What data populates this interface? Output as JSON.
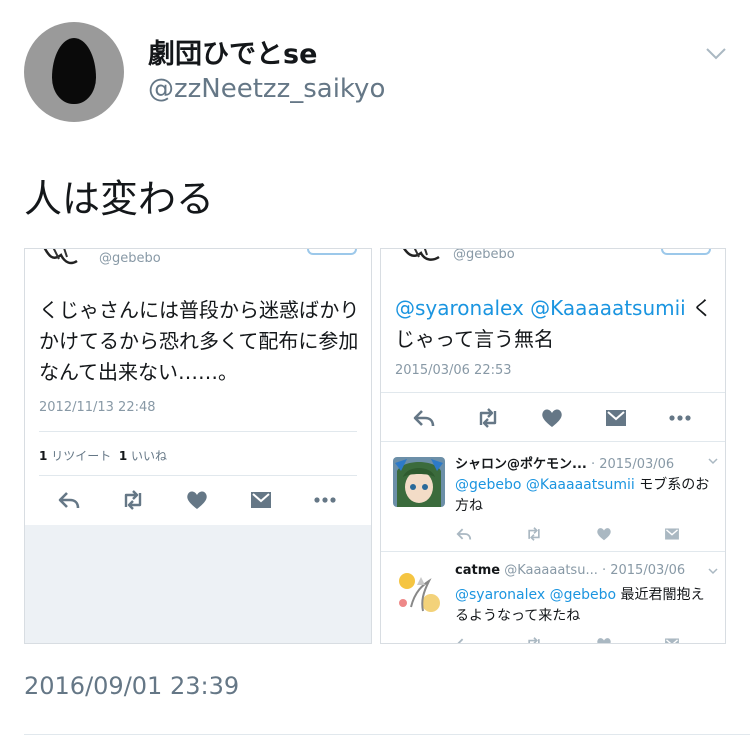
{
  "tweet": {
    "author": {
      "display_name": "劇団ひでとse",
      "handle": "@zzNeetzz_saikyo"
    },
    "text": "人は変わる",
    "timestamp": "2016/09/01 23:39"
  },
  "left_screenshot": {
    "handle": "@gebebo",
    "text": "くじゃさんには普段から迷惑ばかりかけてるから恐れ多くて配布に参加なんて出来ない……。",
    "date": "2012/11/13 22:48",
    "retweets": {
      "count": "1",
      "label": "リツイート"
    },
    "likes": {
      "count": "1",
      "label": "いいね"
    }
  },
  "right_screenshot": {
    "handle": "@gebebo",
    "mentions": "@syaronalex @Kaaaaatsumii",
    "text": "くじゃって言う無名",
    "date": "2015/03/06 22:53",
    "replies": [
      {
        "name": "シャロン@ポケモン...",
        "sub": "",
        "date": "· 2015/03/06",
        "mentions": "@gebebo @Kaaaaatsumii",
        "text": "モブ系のお方ね"
      },
      {
        "name": "catme",
        "sub": "@Kaaaaatsu...",
        "date": "· 2015/03/06",
        "mentions": "@syaronalex @gebebo",
        "text": "最近君闇抱えるようなって来たね"
      }
    ]
  },
  "colors": {
    "link": "#1b95e0",
    "secondary": "#657786",
    "muted": "#8899a6"
  },
  "icons": [
    "chevron-down-icon",
    "reply-icon",
    "retweet-icon",
    "heart-icon",
    "dm-icon",
    "more-icon"
  ]
}
